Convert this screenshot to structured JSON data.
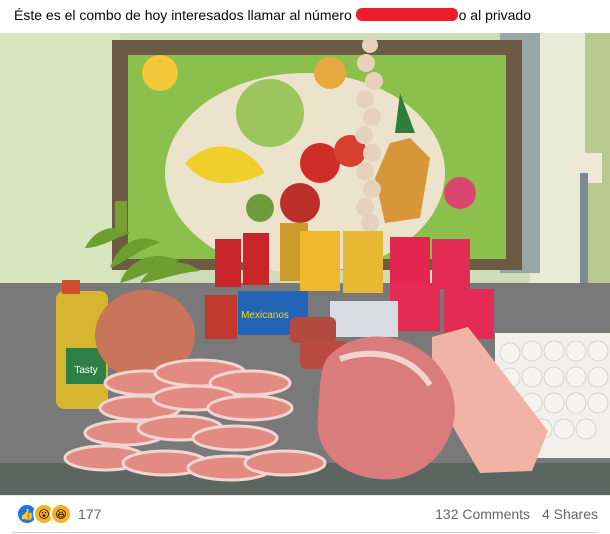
{
  "post": {
    "text_before": "Éste es el combo de hoy interesados llamar al número",
    "text_after": "o al privado"
  },
  "footer": {
    "reactions": [
      "like-icon",
      "wow-icon",
      "haha-icon"
    ],
    "reaction_count": "177",
    "comments": "132 Comments",
    "shares": "4 Shares"
  },
  "photo": {
    "description_labels": {
      "oil": "Tasty",
      "snacks": "Mexicanos"
    }
  }
}
